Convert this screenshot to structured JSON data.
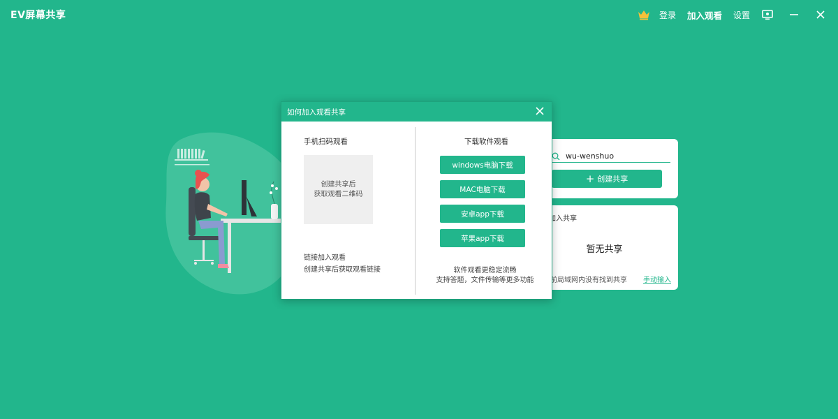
{
  "app": {
    "title": "EV屏幕共享"
  },
  "nav": {
    "login": "登录",
    "join_watch": "加入观看",
    "settings": "设置"
  },
  "share_panel": {
    "device_id": "wu-wenshuo",
    "create_share": "创建共享"
  },
  "join_panel": {
    "label": "加入共享",
    "empty": "暂无共享",
    "lan_hint": "前局域网内没有找到共享",
    "manual_input": "手动输入"
  },
  "modal": {
    "title": "如何加入观看共享",
    "scan_heading": "手机扫码观看",
    "qr_line1": "创建共享后",
    "qr_line2": "获取观看二维码",
    "link_heading": "链接加入观看",
    "link_desc": "创建共享后获取观看链接",
    "download_heading": "下载软件观看",
    "buttons": [
      "windows电脑下载",
      "MAC电脑下载",
      "安卓app下载",
      "苹果app下载"
    ],
    "note_line1": "软件观看更稳定流畅",
    "note_line2": "支持答题，文件传输等更多功能"
  },
  "colors": {
    "brand": "#22b68c",
    "crown": "#f5c13a",
    "chair": "#444a52",
    "hair": "#e8524f"
  }
}
